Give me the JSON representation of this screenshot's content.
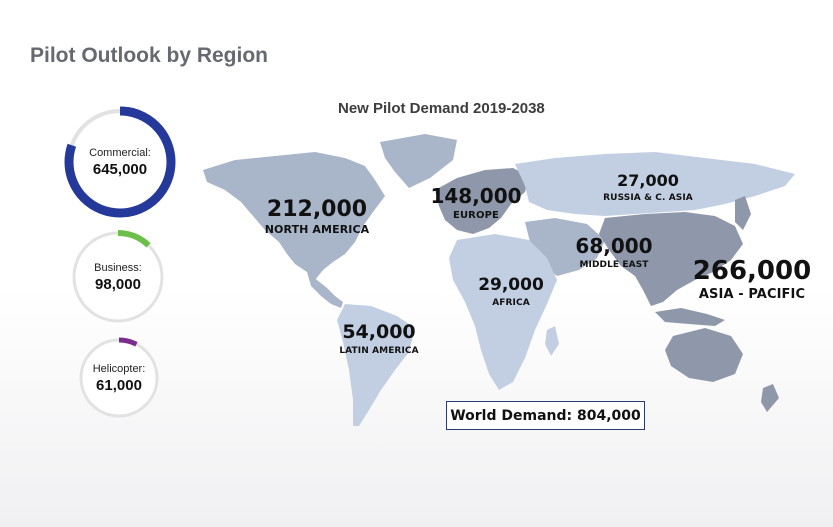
{
  "page": {
    "title": "Pilot Outlook by Region",
    "map_title": "New Pilot Demand 2019-2038"
  },
  "segments": [
    {
      "label": "Commercial:",
      "value": "645,000",
      "share": 0.802,
      "color": "#25399b"
    },
    {
      "label": "Business:",
      "value": "98,000",
      "share": 0.122,
      "color": "#6cc04a"
    },
    {
      "label": "Helicopter:",
      "value": "61,000",
      "share": 0.076,
      "color": "#7b2d8e"
    }
  ],
  "regions": {
    "north_america": {
      "value": "212,000",
      "name": "NORTH AMERICA"
    },
    "europe": {
      "value": "148,000",
      "name": "EUROPE"
    },
    "russia": {
      "value": "27,000",
      "name": "RUSSIA & C. ASIA"
    },
    "middle_east": {
      "value": "68,000",
      "name": "MIDDLE EAST"
    },
    "asia_pacific": {
      "value": "266,000",
      "name": "ASIA - PACIFIC"
    },
    "africa": {
      "value": "29,000",
      "name": "AFRICA"
    },
    "latin_america": {
      "value": "54,000",
      "name": "LATIN AMERICA"
    }
  },
  "world_demand": "World Demand: 804,000",
  "colors": {
    "track": "#e2e2e2",
    "land_light": "#c2cfe3",
    "land_mid": "#a9b5c9",
    "land_dark": "#8e98aa",
    "title": "#666a70"
  }
}
